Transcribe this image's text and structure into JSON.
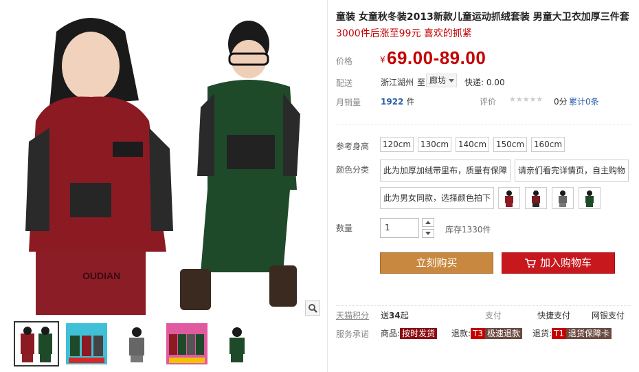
{
  "product": {
    "title": "童装 女童秋冬装2013新款儿童运动抓绒套装 男童大卫衣加厚三件套",
    "subtitle": "3000件后涨至99元 喜欢的抓紧"
  },
  "price": {
    "label": "价格",
    "currency": "¥",
    "value": "69.00-89.00"
  },
  "shipping": {
    "label": "配送",
    "from": "浙江湖州",
    "to_label": "至",
    "to": "廊坊",
    "express": "快递: 0.00"
  },
  "sales": {
    "label": "月销量",
    "count": "1922",
    "unit": "件",
    "rating_label": "评价",
    "stars": "★★★★★",
    "score": "0分",
    "reviews": "累计0条"
  },
  "size": {
    "label": "参考身高",
    "options": [
      "120cm",
      "130cm",
      "140cm",
      "150cm",
      "160cm"
    ]
  },
  "color": {
    "label": "颜色分类",
    "text_options": [
      "此为加厚加绒带里布，质量有保障",
      "请亲们看完详情页，自主购物",
      "此为男女同款，选择颜色拍下"
    ]
  },
  "quantity": {
    "label": "数量",
    "value": "1",
    "stock": "库存1330件"
  },
  "actions": {
    "buy_label": "立刻购买",
    "cart_label": "加入购物车"
  },
  "services": {
    "points_label": "天猫积分",
    "points_prefix": "送",
    "points_value": "34",
    "points_suffix": "起",
    "pay_label": "支付",
    "pay_quick": "快捷支付",
    "pay_bank": "网银支付",
    "promise_label": "服务承诺",
    "goods_label": "商品:",
    "goods_tag": "按时发货",
    "refund_label": "退款:",
    "refund_code": "T3",
    "refund_tag": "极速退款",
    "return_label": "退货:",
    "return_code": "T1",
    "return_tag": "退货保障卡"
  },
  "colors": {
    "price_red": "#c40000",
    "buy_orange": "#c8883f",
    "cart_red": "#c7181e",
    "link_blue": "#2b5fa8"
  },
  "icons": [
    "magnifier-icon",
    "cart-icon",
    "caret-down-icon",
    "star-icon"
  ]
}
